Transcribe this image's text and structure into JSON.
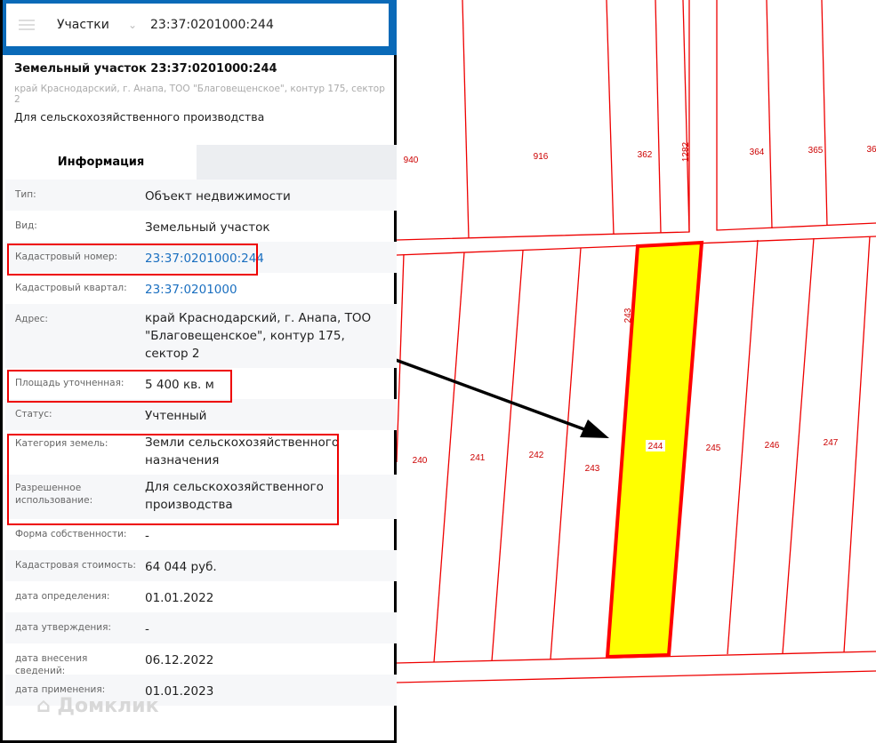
{
  "search": {
    "category": "Участки",
    "query": "23:37:0201000:244"
  },
  "object": {
    "title": "Земельный участок 23:37:0201000:244",
    "address": "край Краснодарский, г. Анапа, ТОО \"Благовещенское\", контур 175, сектор 2",
    "purpose": "Для сельскохозяйственного производства"
  },
  "tabs": [
    {
      "label": "Информация",
      "active": true
    }
  ],
  "info": [
    {
      "label": "Тип:",
      "value": "Объект недвижимости"
    },
    {
      "label": "Вид:",
      "value": "Земельный участок"
    },
    {
      "label": "Кадастровый номер:",
      "value": "23:37:0201000:244",
      "link": true
    },
    {
      "label": "Кадастровый квартал:",
      "value": "23:37:0201000",
      "link": true
    },
    {
      "label": "Адрес:",
      "value": "край Краснодарский, г. Анапа, ТОО \"Благовещенское\", контур 175, сектор 2"
    },
    {
      "label": "Площадь уточненная:",
      "value": "5 400 кв. м"
    },
    {
      "label": "Статус:",
      "value": "Учтенный"
    },
    {
      "label": "Категория земель:",
      "value": "Земли сельскохозяйственного назначения"
    },
    {
      "label": "Разрешенное использование:",
      "value": "Для сельскохозяйственного производства"
    },
    {
      "label": "Форма собственности:",
      "value": "-"
    },
    {
      "label": "Кадастровая стоимость:",
      "value": "64 044 руб."
    },
    {
      "label": "дата определения:",
      "value": "01.01.2022"
    },
    {
      "label": "дата утверждения:",
      "value": "-"
    },
    {
      "label": "дата внесения сведений:",
      "value": "06.12.2022"
    },
    {
      "label": "дата применения:",
      "value": "01.01.2023"
    }
  ],
  "watermark": "Домклик",
  "map": {
    "parcels_upper": [
      "940",
      "916",
      "362",
      "1282",
      "364",
      "365",
      "36"
    ],
    "parcels_lower": [
      "240",
      "241",
      "242",
      "243",
      "243",
      "244",
      "245",
      "246",
      "247"
    ],
    "selected": "244",
    "line_color": "#e00000",
    "highlight_color": "#ffff00"
  }
}
